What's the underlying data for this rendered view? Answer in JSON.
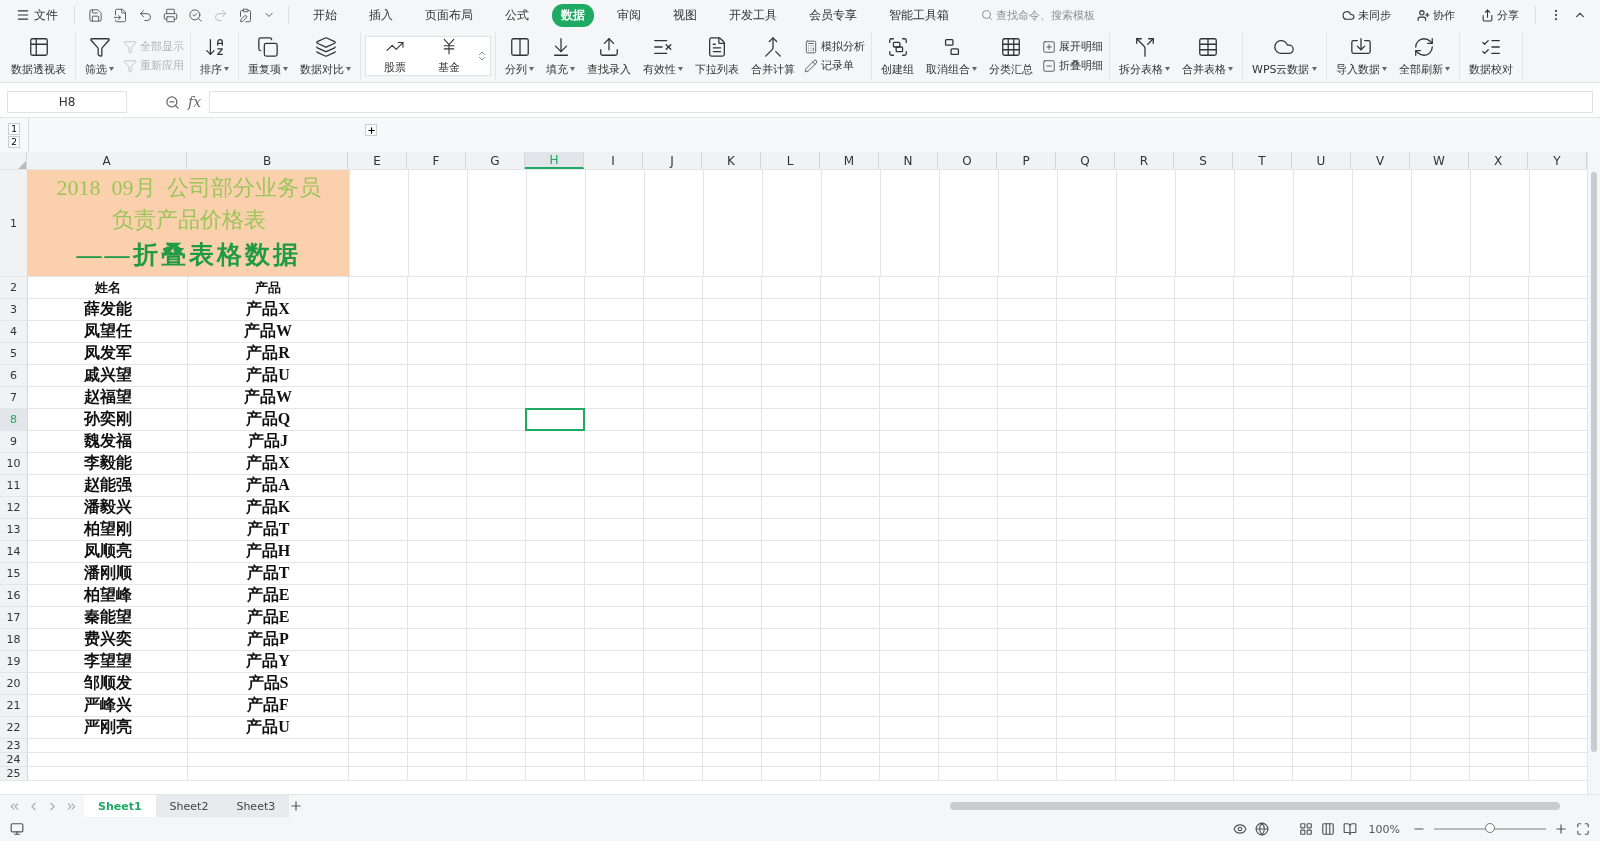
{
  "menu_bar": {
    "file": "文件",
    "tabs": [
      {
        "label": "开始",
        "selected": false
      },
      {
        "label": "插入",
        "selected": false
      },
      {
        "label": "页面布局",
        "selected": false
      },
      {
        "label": "公式",
        "selected": false
      },
      {
        "label": "数据",
        "selected": true
      },
      {
        "label": "审阅",
        "selected": false
      },
      {
        "label": "视图",
        "selected": false
      },
      {
        "label": "开发工具",
        "selected": false
      },
      {
        "label": "会员专享",
        "selected": false
      },
      {
        "label": "智能工具箱",
        "selected": false
      }
    ],
    "search": {
      "placeholder": "查找命令、搜索模板"
    },
    "actions": [
      "未同步",
      "协作",
      "分享"
    ]
  },
  "ribbon": [
    {
      "items": [
        {
          "kind": "large",
          "label": "数据透视表",
          "menu": false
        }
      ]
    },
    {
      "items": [
        {
          "kind": "large",
          "label": "筛选",
          "menu": true
        },
        {
          "kind": "stack",
          "items": [
            {
              "label": "全部显示",
              "disabled": true
            },
            {
              "label": "重新应用",
              "disabled": true
            }
          ]
        }
      ]
    },
    {
      "items": [
        {
          "kind": "large",
          "label": "排序",
          "menu": true
        }
      ]
    },
    {
      "items": [
        {
          "kind": "large",
          "label": "重复项",
          "menu": true
        },
        {
          "kind": "large",
          "label": "数据对比",
          "menu": true
        }
      ]
    },
    {
      "items": [
        {
          "kind": "gallery",
          "items": [
            {
              "label": "股票"
            },
            {
              "label": "基金"
            }
          ]
        }
      ]
    },
    {
      "items": [
        {
          "kind": "large",
          "label": "分列",
          "menu": true
        },
        {
          "kind": "large",
          "label": "填充",
          "menu": true
        },
        {
          "kind": "large",
          "label": "查找录入",
          "menu": false
        },
        {
          "kind": "large",
          "label": "有效性",
          "menu": true
        },
        {
          "kind": "large",
          "label": "下拉列表",
          "menu": false
        },
        {
          "kind": "large",
          "label": "合并计算",
          "menu": false
        },
        {
          "kind": "stack",
          "items": [
            {
              "label": "模拟分析",
              "disabled": false
            },
            {
              "label": "记录单",
              "disabled": false
            }
          ]
        }
      ]
    },
    {
      "items": [
        {
          "kind": "large",
          "label": "创建组",
          "menu": false
        },
        {
          "kind": "large",
          "label": "取消组合",
          "menu": true
        },
        {
          "kind": "large",
          "label": "分类汇总",
          "menu": false
        },
        {
          "kind": "stack",
          "items": [
            {
              "label": "展开明细",
              "disabled": false
            },
            {
              "label": "折叠明细",
              "disabled": false
            }
          ]
        }
      ]
    },
    {
      "items": [
        {
          "kind": "large",
          "label": "拆分表格",
          "menu": true
        },
        {
          "kind": "large",
          "label": "合并表格",
          "menu": true
        }
      ]
    },
    {
      "items": [
        {
          "kind": "large",
          "label": "WPS云数据",
          "menu": true
        }
      ]
    },
    {
      "items": [
        {
          "kind": "large",
          "label": "导入数据",
          "menu": true
        },
        {
          "kind": "large",
          "label": "全部刷新",
          "menu": true
        }
      ]
    },
    {
      "items": [
        {
          "kind": "large",
          "label": "数据校对",
          "menu": false
        }
      ]
    }
  ],
  "formula_bar": {
    "name_box": "H8",
    "fx": "fx"
  },
  "outline_levels": [
    "1",
    "2"
  ],
  "sheet": {
    "columns": [
      {
        "label": "A",
        "selected": false
      },
      {
        "label": "B",
        "selected": false
      },
      {
        "label": "E",
        "selected": false
      },
      {
        "label": "F",
        "selected": false
      },
      {
        "label": "G",
        "selected": false
      },
      {
        "label": "H",
        "selected": true
      },
      {
        "label": "I",
        "selected": false
      },
      {
        "label": "J",
        "selected": false
      },
      {
        "label": "K",
        "selected": false
      },
      {
        "label": "L",
        "selected": false
      },
      {
        "label": "M",
        "selected": false
      },
      {
        "label": "N",
        "selected": false
      },
      {
        "label": "O",
        "selected": false
      },
      {
        "label": "P",
        "selected": false
      },
      {
        "label": "Q",
        "selected": false
      },
      {
        "label": "R",
        "selected": false
      },
      {
        "label": "S",
        "selected": false
      },
      {
        "label": "T",
        "selected": false
      },
      {
        "label": "U",
        "selected": false
      },
      {
        "label": "V",
        "selected": false
      },
      {
        "label": "W",
        "selected": false
      },
      {
        "label": "X",
        "selected": false
      },
      {
        "label": "Y",
        "selected": false
      }
    ],
    "title": {
      "row": "1",
      "lines": [
        "2018  09月  公司部分业务员",
        "负责产品价格表"
      ],
      "subtitle": "——折叠表格数据"
    },
    "header_row": {
      "row": "2",
      "cells": [
        "姓名",
        "产品"
      ]
    },
    "rows": [
      {
        "header": "3",
        "selected": false,
        "cells": [
          "薛发能",
          "产品X"
        ]
      },
      {
        "header": "4",
        "selected": false,
        "cells": [
          "凤望任",
          "产品W"
        ]
      },
      {
        "header": "5",
        "selected": false,
        "cells": [
          "凤发军",
          "产品R"
        ]
      },
      {
        "header": "6",
        "selected": false,
        "cells": [
          "戚兴望",
          "产品U"
        ]
      },
      {
        "header": "7",
        "selected": false,
        "cells": [
          "赵福望",
          "产品W"
        ]
      },
      {
        "header": "8",
        "selected": true,
        "cells": [
          "孙奕刚",
          "产品Q"
        ]
      },
      {
        "header": "9",
        "selected": false,
        "cells": [
          "魏发福",
          "产品J"
        ]
      },
      {
        "header": "10",
        "selected": false,
        "cells": [
          "李毅能",
          "产品X"
        ]
      },
      {
        "header": "11",
        "selected": false,
        "cells": [
          "赵能强",
          "产品A"
        ]
      },
      {
        "header": "12",
        "selected": false,
        "cells": [
          "潘毅兴",
          "产品K"
        ]
      },
      {
        "header": "13",
        "selected": false,
        "cells": [
          "柏望刚",
          "产品T"
        ]
      },
      {
        "header": "14",
        "selected": false,
        "cells": [
          "凤顺亮",
          "产品H"
        ]
      },
      {
        "header": "15",
        "selected": false,
        "cells": [
          "潘刚顺",
          "产品T"
        ]
      },
      {
        "header": "16",
        "selected": false,
        "cells": [
          "柏望峰",
          "产品E"
        ]
      },
      {
        "header": "17",
        "selected": false,
        "cells": [
          "秦能望",
          "产品E"
        ]
      },
      {
        "header": "18",
        "selected": false,
        "cells": [
          "费兴奕",
          "产品P"
        ]
      },
      {
        "header": "19",
        "selected": false,
        "cells": [
          "李望望",
          "产品Y"
        ]
      },
      {
        "header": "20",
        "selected": false,
        "cells": [
          "邹顺发",
          "产品S"
        ]
      },
      {
        "header": "21",
        "selected": false,
        "cells": [
          "严峰兴",
          "产品F"
        ]
      },
      {
        "header": "22",
        "selected": false,
        "cells": [
          "严刚亮",
          "产品U"
        ]
      }
    ],
    "empty_rows": [
      "23",
      "24",
      "25"
    ]
  },
  "sheet_tabs": [
    {
      "label": "Sheet1",
      "selected": true
    },
    {
      "label": "Sheet2",
      "selected": false
    },
    {
      "label": "Sheet3",
      "selected": false
    }
  ],
  "status_bar": {
    "zoom": {
      "reading": "100%",
      "level": 0.5
    }
  }
}
